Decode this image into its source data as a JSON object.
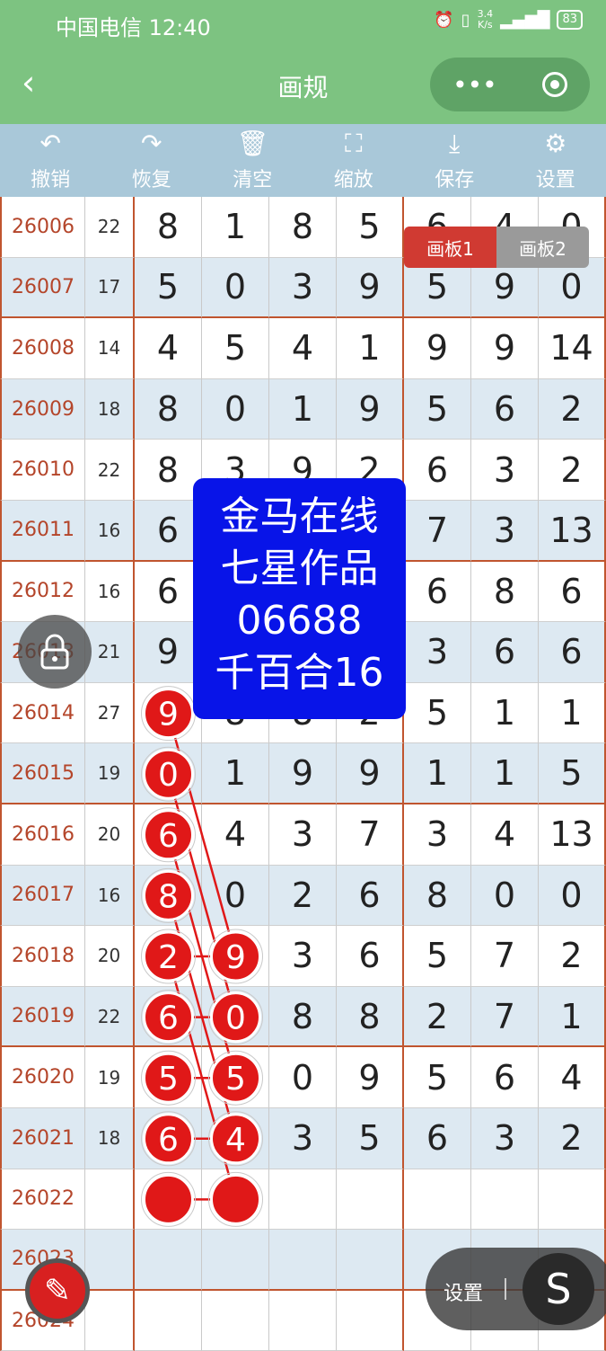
{
  "status": {
    "carrier_time": "中国电信 12:40",
    "speed_top": "3.4",
    "speed_bottom": "K/s",
    "battery": "83"
  },
  "titlebar": {
    "back_icon": "chevron-left-icon",
    "title": "画规"
  },
  "toolbar": {
    "items": [
      {
        "label": "撤销",
        "icon": "undo-icon"
      },
      {
        "label": "恢复",
        "icon": "redo-icon"
      },
      {
        "label": "清空",
        "icon": "trash-icon"
      },
      {
        "label": "缩放",
        "icon": "zoom-icon"
      },
      {
        "label": "保存",
        "icon": "download-icon"
      },
      {
        "label": "设置",
        "icon": "gear-icon"
      }
    ]
  },
  "panel_tabs": {
    "tab1": "画板1",
    "tab2": "画板2"
  },
  "watermark": {
    "line1": "金马在线",
    "line2": "七星作品",
    "line3": "06688",
    "line4": "千百合16"
  },
  "floatbar": {
    "settings_label": "设置",
    "s_label": "S"
  },
  "rows": [
    {
      "issue": "26006",
      "sum": "22",
      "d": [
        "8",
        "1",
        "8",
        "5",
        "6",
        "4",
        "0"
      ]
    },
    {
      "issue": "26007",
      "sum": "17",
      "d": [
        "5",
        "0",
        "3",
        "9",
        "5",
        "9",
        "0"
      ]
    },
    {
      "issue": "26008",
      "sum": "14",
      "d": [
        "4",
        "5",
        "4",
        "1",
        "9",
        "9",
        "14"
      ]
    },
    {
      "issue": "26009",
      "sum": "18",
      "d": [
        "8",
        "0",
        "1",
        "9",
        "5",
        "6",
        "2"
      ]
    },
    {
      "issue": "26010",
      "sum": "22",
      "d": [
        "8",
        "3",
        "9",
        "2",
        "6",
        "3",
        "2"
      ]
    },
    {
      "issue": "26011",
      "sum": "16",
      "d": [
        "6",
        "",
        "",
        "",
        "7",
        "3",
        "13"
      ]
    },
    {
      "issue": "26012",
      "sum": "16",
      "d": [
        "6",
        "",
        "",
        "",
        "6",
        "8",
        "6"
      ]
    },
    {
      "issue": "26013",
      "sum": "21",
      "d": [
        "9",
        "",
        "",
        "",
        "3",
        "6",
        "6"
      ]
    },
    {
      "issue": "26014",
      "sum": "27",
      "d": [
        "9",
        "8",
        "8",
        "2",
        "5",
        "1",
        "1"
      ]
    },
    {
      "issue": "26015",
      "sum": "19",
      "d": [
        "0",
        "1",
        "9",
        "9",
        "1",
        "1",
        "5"
      ]
    },
    {
      "issue": "26016",
      "sum": "20",
      "d": [
        "6",
        "4",
        "3",
        "7",
        "3",
        "4",
        "13"
      ]
    },
    {
      "issue": "26017",
      "sum": "16",
      "d": [
        "8",
        "0",
        "2",
        "6",
        "8",
        "0",
        "0"
      ]
    },
    {
      "issue": "26018",
      "sum": "20",
      "d": [
        "2",
        "9",
        "3",
        "6",
        "5",
        "7",
        "2"
      ]
    },
    {
      "issue": "26019",
      "sum": "22",
      "d": [
        "6",
        "0",
        "8",
        "8",
        "2",
        "7",
        "1"
      ]
    },
    {
      "issue": "26020",
      "sum": "19",
      "d": [
        "5",
        "5",
        "0",
        "9",
        "5",
        "6",
        "4"
      ]
    },
    {
      "issue": "26021",
      "sum": "18",
      "d": [
        "6",
        "4",
        "3",
        "5",
        "6",
        "3",
        "2"
      ]
    },
    {
      "issue": "26022",
      "sum": "",
      "d": [
        "",
        "",
        "",
        "",
        "",
        "",
        ""
      ]
    },
    {
      "issue": "26023",
      "sum": "",
      "d": [
        "",
        "",
        "",
        "",
        "",
        "",
        ""
      ]
    },
    {
      "issue": "26024",
      "sum": "",
      "d": [
        "",
        "",
        "",
        "",
        "",
        "",
        ""
      ]
    }
  ],
  "marked": [
    {
      "row": 8,
      "col": 0
    },
    {
      "row": 9,
      "col": 0
    },
    {
      "row": 10,
      "col": 0
    },
    {
      "row": 11,
      "col": 0
    },
    {
      "row": 12,
      "col": 0
    },
    {
      "row": 13,
      "col": 0
    },
    {
      "row": 14,
      "col": 0
    },
    {
      "row": 15,
      "col": 0
    },
    {
      "row": 16,
      "col": 0
    },
    {
      "row": 12,
      "col": 1
    },
    {
      "row": 13,
      "col": 1
    },
    {
      "row": 14,
      "col": 1
    },
    {
      "row": 15,
      "col": 1
    },
    {
      "row": 16,
      "col": 1
    }
  ],
  "colors": {
    "header_green": "#7dc381",
    "toolbar_blue": "#a9c8d9",
    "row_blue": "#dde9f2",
    "issue_red": "#b4452a",
    "mark_red": "#e01818",
    "watermark_blue": "#0814e8"
  }
}
